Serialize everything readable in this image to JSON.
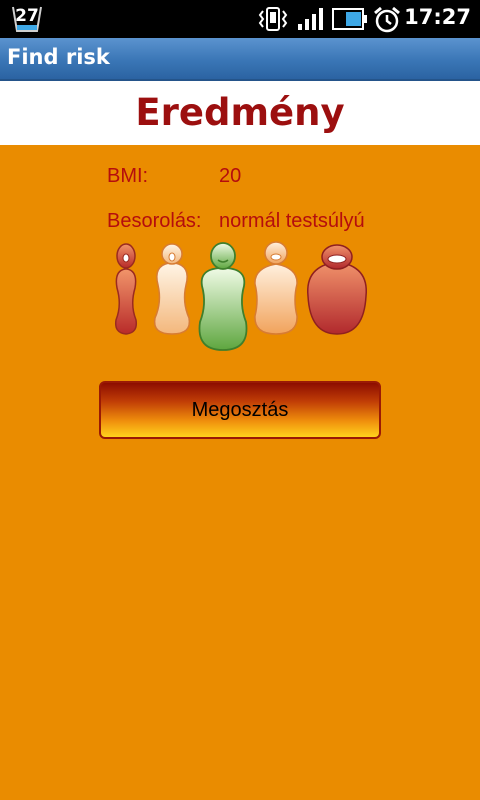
{
  "status_bar": {
    "notification_count": "27",
    "time": "17:27",
    "icons": [
      "notification-icon",
      "vibrate-icon",
      "signal-icon",
      "battery-icon",
      "alarm-icon"
    ]
  },
  "app_bar": {
    "title": "Find risk"
  },
  "result": {
    "heading": "Eredmény",
    "bmi_label": "BMI:",
    "bmi_value": "20",
    "category_label": "Besorolás:",
    "category_value": "normál testsúlyú",
    "selected_figure_index": 2
  },
  "figures": [
    {
      "name": "underweight-severe-figure",
      "color": "#d04a37"
    },
    {
      "name": "underweight-figure",
      "color": "#f8c99a"
    },
    {
      "name": "normal-figure",
      "color": "#8fc873"
    },
    {
      "name": "overweight-figure",
      "color": "#f5b87d"
    },
    {
      "name": "obese-figure",
      "color": "#c84038"
    }
  ],
  "share_button": {
    "label": "Megosztás"
  },
  "colors": {
    "background": "#ea8c00",
    "accent_text": "#b50d0d",
    "heading_text": "#9c0f0f",
    "title_bar": "#3a76b6"
  }
}
